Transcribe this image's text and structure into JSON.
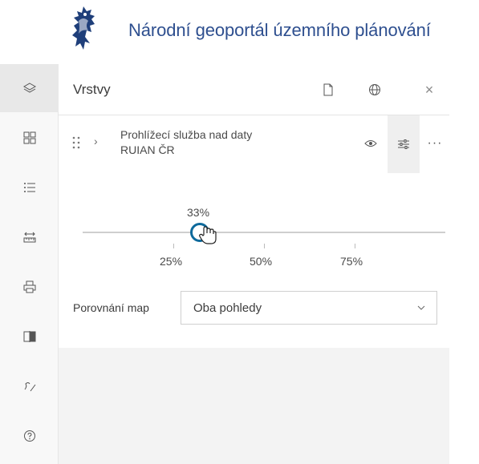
{
  "header": {
    "title": "Národní geoportál územního plánování",
    "logo_icon": "lion-emblem-icon"
  },
  "toolbar": {
    "items": [
      {
        "icon": "layers-icon",
        "active": true
      },
      {
        "icon": "basemap-gallery-icon"
      },
      {
        "icon": "legend-list-icon"
      },
      {
        "icon": "measure-ruler-icon"
      },
      {
        "icon": "print-icon"
      },
      {
        "icon": "swipe-compare-icon"
      },
      {
        "icon": "sketch-draw-icon"
      },
      {
        "icon": "help-icon"
      }
    ]
  },
  "panel": {
    "title": "Vrstvy",
    "layer": {
      "name_line1": "Prohlížecí služba nad daty",
      "name_line2": "RUIAN ČR",
      "more_label": "···"
    },
    "transparency": {
      "value_label": "33%",
      "value": 0.33,
      "ticks": [
        "25%",
        "50%",
        "75%"
      ]
    },
    "compare": {
      "label": "Porovnání map",
      "selected": "Oba pohledy"
    },
    "close_label": "×"
  },
  "colors": {
    "title_blue": "#2e4f8f",
    "slider_accent": "#0e6a9c"
  }
}
